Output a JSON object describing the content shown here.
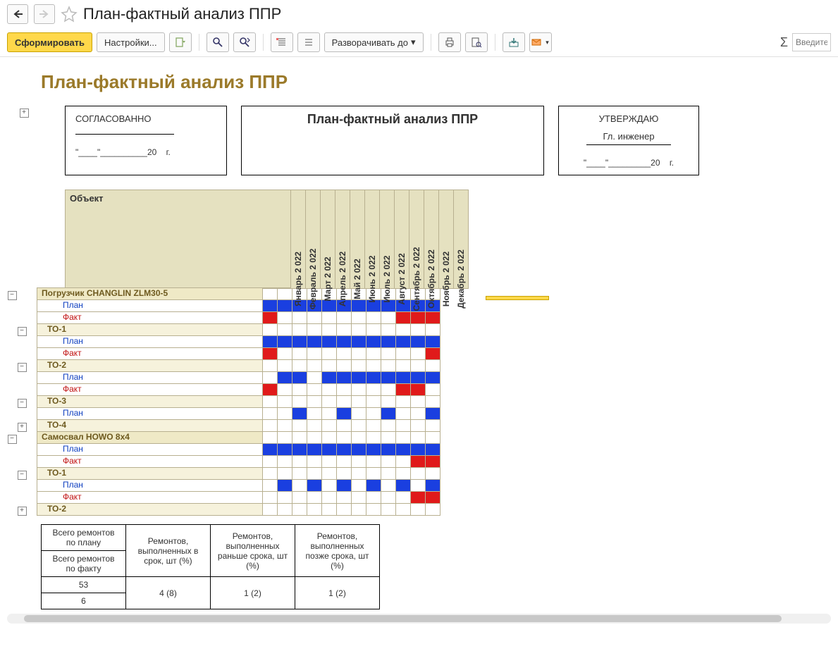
{
  "title": "План-фактный анализ ППР",
  "toolbar": {
    "generate": "Сформировать",
    "settings": "Настройки...",
    "expand_to": "Разворачивать до"
  },
  "search_placeholder": "Введите",
  "report": {
    "heading": "План-фактный анализ ППР",
    "approved_left": "СОГЛАСОВАННО",
    "approved_left_date": "\"____\"__________20    г.",
    "center_title": "План-фактный анализ ППР",
    "approved_right_1": "УТВЕРЖДАЮ",
    "approved_right_2": "Гл. инженер",
    "approved_right_date": "\"____\"_________20    г.",
    "object_header": "Объект",
    "months": [
      "Январь 2 022",
      "Февраль 2 022",
      "Март 2 022",
      "Апрель 2 022",
      "Май 2 022",
      "Июнь 2 022",
      "Июль 2 022",
      "Август 2 022",
      "Сентябрь 2 022",
      "Октябрь 2 022",
      "Ноябрь 2 022",
      "Декабрь 2 022"
    ],
    "labels": {
      "plan": "План",
      "fact": "Факт"
    },
    "rows": [
      {
        "type": "group",
        "label": "Погрузчик CHANGLIN ZLM30-5",
        "tree": "minus"
      },
      {
        "type": "plan",
        "cells": [
          1,
          1,
          1,
          1,
          1,
          1,
          1,
          1,
          1,
          1,
          1,
          1
        ]
      },
      {
        "type": "fact",
        "cells": [
          2,
          0,
          0,
          0,
          0,
          0,
          0,
          0,
          0,
          2,
          2,
          2
        ]
      },
      {
        "type": "sub",
        "label": "ТО-1",
        "tree": "minus"
      },
      {
        "type": "plan",
        "cells": [
          1,
          1,
          1,
          1,
          1,
          1,
          1,
          1,
          1,
          1,
          1,
          1
        ]
      },
      {
        "type": "fact",
        "cells": [
          2,
          0,
          0,
          0,
          0,
          0,
          0,
          0,
          0,
          0,
          0,
          2
        ]
      },
      {
        "type": "sub",
        "label": "ТО-2",
        "tree": "minus"
      },
      {
        "type": "plan",
        "cells": [
          0,
          1,
          1,
          0,
          1,
          1,
          1,
          1,
          1,
          1,
          1,
          1
        ]
      },
      {
        "type": "fact",
        "cells": [
          2,
          0,
          0,
          0,
          0,
          0,
          0,
          0,
          0,
          2,
          2,
          0
        ]
      },
      {
        "type": "sub",
        "label": "ТО-3",
        "tree": "minus"
      },
      {
        "type": "plan",
        "cells": [
          0,
          0,
          1,
          0,
          0,
          1,
          0,
          0,
          1,
          0,
          0,
          1
        ]
      },
      {
        "type": "sub",
        "label": "ТО-4",
        "tree": "plus"
      },
      {
        "type": "group",
        "label": "Самосвал HOWO 8x4",
        "tree": "minus"
      },
      {
        "type": "plan",
        "cells": [
          1,
          1,
          1,
          1,
          1,
          1,
          1,
          1,
          1,
          1,
          1,
          1
        ]
      },
      {
        "type": "fact",
        "cells": [
          0,
          0,
          0,
          0,
          0,
          0,
          0,
          0,
          0,
          0,
          2,
          2
        ]
      },
      {
        "type": "sub",
        "label": "ТО-1",
        "tree": "minus"
      },
      {
        "type": "plan",
        "cells": [
          0,
          1,
          0,
          1,
          0,
          1,
          0,
          1,
          0,
          1,
          0,
          1
        ]
      },
      {
        "type": "fact",
        "cells": [
          0,
          0,
          0,
          0,
          0,
          0,
          0,
          0,
          0,
          0,
          2,
          2
        ]
      },
      {
        "type": "sub",
        "label": "ТО-2",
        "tree": "plus"
      }
    ]
  },
  "summary": {
    "h1": "Всего ремонтов по плану",
    "h2": "Всего ремонтов по факту",
    "h3": "Ремонтов, выполненных в срок, шт (%)",
    "h4": "Ремонтов, выполненных раньше срока, шт (%)",
    "h5": "Ремонтов, выполненных позже срока, шт (%)",
    "v_plan": "53",
    "v_fact": "6",
    "v_on": "4 (8)",
    "v_early": "1 (2)",
    "v_late": "1 (2)"
  }
}
